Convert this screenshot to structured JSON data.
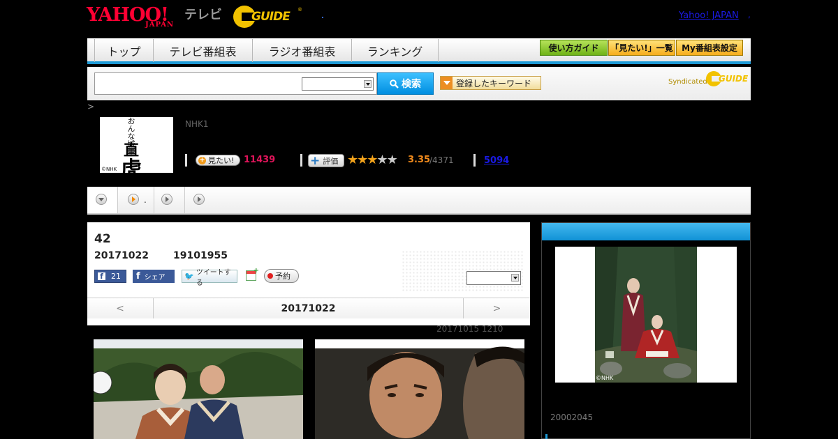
{
  "header": {
    "yahoo_logo": "YAHOO!",
    "yahoo_logo_sub": "JAPAN",
    "tv_label": "テレビ",
    "gguide_logo": "GUIDE",
    "yahoo_japan_link": "Yahoo! JAPAN",
    "link_sep": ","
  },
  "nav": {
    "tabs": [
      "トップ",
      "テレビ番組表",
      "ラジオ番組表",
      "ランキング"
    ],
    "buttons": [
      "使い方ガイド",
      "「見たい!」一覧",
      "My番組表設定"
    ]
  },
  "search": {
    "input_value": "",
    "select_value": "",
    "button_label": "検索",
    "keyword_button": "登録したキーワード",
    "syndicated_label": "Syndicated",
    "syndicated_logo": "GUIDE"
  },
  "breadcrumb": ">",
  "program": {
    "thumb_text_small": "おんな城主",
    "thumb_text_1": "直",
    "thumb_text_2": "虎",
    "thumb_credit": "©NHK",
    "channel": "NHK1",
    "mitai_label": "見たい!",
    "mitai_count": "11439",
    "rate_label": "評価",
    "rating_stars": 3.35,
    "rating_value": "3.35",
    "rating_count": "/4371",
    "review_count": "5094",
    "star_symbol": "★"
  },
  "subtabs": {
    "tab2_label": "."
  },
  "episode": {
    "number": "42",
    "date": "20171022",
    "time": "19101955",
    "like_count": "21",
    "share_label": "シェア",
    "tweet_label": "ツイートする",
    "reserve_label": "予約",
    "select_value": "",
    "nav_prev": "<",
    "nav_current": "20171022",
    "nav_next": ">",
    "note": "20171015  1210"
  },
  "side": {
    "photo_credit": "©NHK",
    "date_text": "20002045"
  },
  "colors": {
    "accent_blue": "#1e9ad6",
    "mitai_pink": "#e0145a",
    "rating_orange": "#f08a1c",
    "yahoo_red": "#ff0033",
    "gguide_yellow": "#f2c200"
  },
  "icons": [
    "search-icon",
    "dropdown-arrow-icon",
    "plus-icon",
    "star-icon",
    "facebook-icon",
    "twitter-bird-icon",
    "calendar-add-icon",
    "record-icon",
    "play-circle-icon",
    "chevron-down-circle-icon"
  ]
}
